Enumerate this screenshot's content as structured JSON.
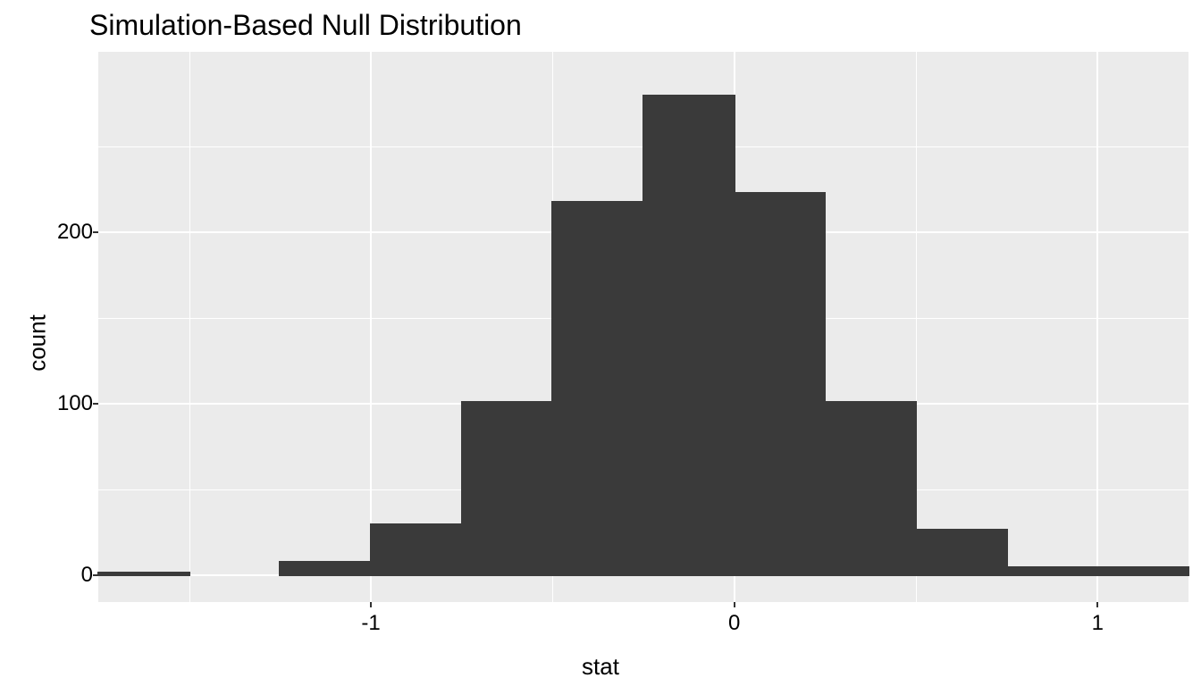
{
  "chart_data": {
    "type": "bar",
    "title": "Simulation-Based Null Distribution",
    "xlabel": "stat",
    "ylabel": "count",
    "xlim": [
      -1.75,
      1.25
    ],
    "ylim": [
      0,
      290
    ],
    "x_ticks": [
      -1,
      0,
      1
    ],
    "y_ticks": [
      0,
      100,
      200
    ],
    "y_minor": [
      50,
      150,
      250
    ],
    "x_minor": [
      -1.5,
      -0.5,
      0.5
    ],
    "bin_width": 0.25,
    "bin_centers": [
      -1.625,
      -1.375,
      -1.125,
      -0.875,
      -0.625,
      -0.375,
      -0.125,
      0.125,
      0.375,
      0.625,
      0.875,
      1.125
    ],
    "values": [
      2,
      0,
      8,
      30,
      101,
      218,
      280,
      223,
      101,
      27,
      5,
      5
    ]
  },
  "colors": {
    "panel_bg": "#ebebeb",
    "grid": "#ffffff",
    "bar_fill": "#3a3a3a"
  }
}
